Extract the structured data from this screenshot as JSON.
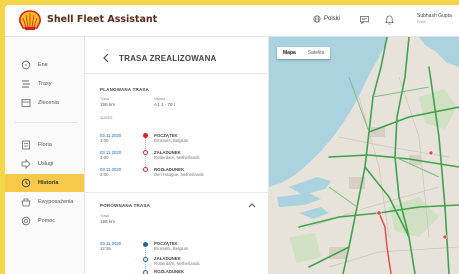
{
  "app": {
    "title": "Shell Fleet Assistant"
  },
  "header": {
    "language": "Polski",
    "user_name": "Subhash Gupta",
    "user_sub": "Shell"
  },
  "sidebar": {
    "items": [
      {
        "label": "Ene",
        "icon": "circle-icon"
      },
      {
        "label": "Trasy",
        "icon": "routes-icon"
      },
      {
        "label": "Zlecenia",
        "icon": "orders-icon"
      },
      {
        "label": "Floria",
        "icon": "fleet-icon"
      },
      {
        "label": "Usługi",
        "icon": "services-icon"
      },
      {
        "label": "Historia",
        "icon": "history-icon",
        "active": true
      },
      {
        "label": "Ewyposażenia",
        "icon": "equipment-icon"
      },
      {
        "label": "Pomoc",
        "icon": "help-icon"
      }
    ]
  },
  "panel": {
    "title": "TRASA ZREALIZOWANA",
    "planned": {
      "heading": "PLANOWANA TRASA",
      "dist_label": "Trasa",
      "dist_value": "156 km",
      "time_label": "Nazwa",
      "time_value": "A1 1 - 76 I",
      "stops_label": "ADRES",
      "stops": [
        {
          "date": "03.11.2020",
          "time": "3:00",
          "name": "POCZĄTEK",
          "addr": "Brussels, Belgium",
          "color": "#dd2222",
          "filled": true
        },
        {
          "date": "03.11.2020",
          "time": "3:00",
          "name": "ZAŁADUNEK",
          "addr": "Rotterdam, Netherlands",
          "color": "#dd2222",
          "filled": false
        },
        {
          "date": "03.11.2020",
          "time": "2:00",
          "name": "ROZŁADUNEK",
          "addr": "Den Haague, Netherlands",
          "color": "#dd2222",
          "filled": false
        }
      ]
    },
    "actual": {
      "heading": "PORÓWNANA TRASA",
      "dist_label": "Trasa",
      "dist_value": "156 km",
      "stops": [
        {
          "date": "03.11.2020",
          "time": "12:36",
          "name": "POCZĄTEK",
          "addr": "Brussels, Belgium",
          "color": "#1a64b0",
          "filled": true
        },
        {
          "date": "",
          "time": "",
          "name": "ZAŁADUNEK",
          "addr": "Rotterdam, Netherlands",
          "color": "#1a64b0",
          "filled": false
        },
        {
          "date": "",
          "time": "",
          "name": "ROZŁADUNEK",
          "addr": "",
          "color": "#1a64b0",
          "filled": false
        }
      ]
    }
  },
  "map": {
    "tabs": [
      "Mapa",
      "Satelita"
    ],
    "selected_tab": "Mapa"
  },
  "colors": {
    "brand_yellow": "#f7c948",
    "brand_red": "#dd1d21",
    "route_blue": "#1a64b0"
  }
}
